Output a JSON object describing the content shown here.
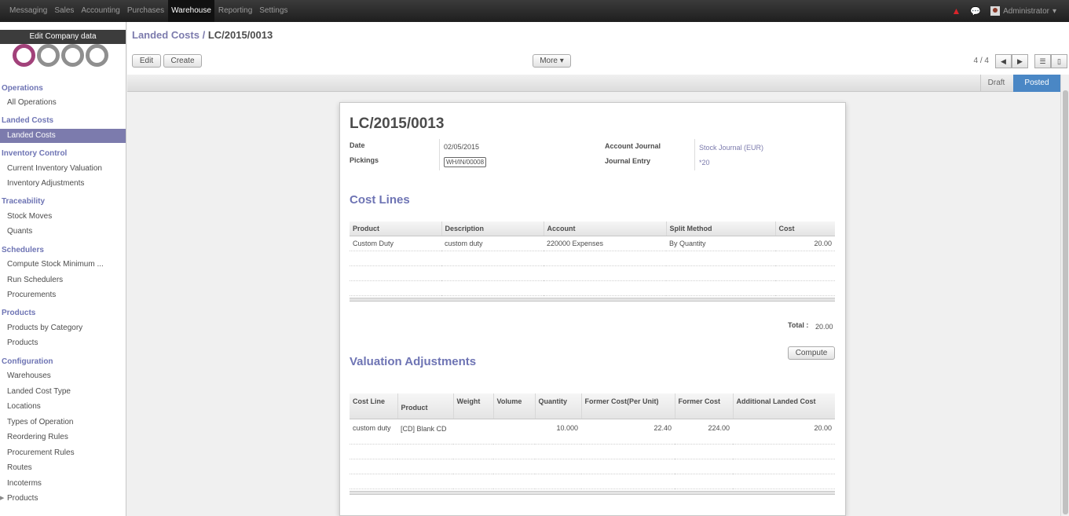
{
  "topbar": {
    "menu": [
      "Messaging",
      "Sales",
      "Accounting",
      "Purchases",
      "Warehouse",
      "Reporting",
      "Settings"
    ],
    "active": "Warehouse",
    "user": "Administrator",
    "caret": "▾"
  },
  "sidebar": {
    "edit_company": "Edit Company data",
    "operations": "Operations",
    "all_operations": "All Operations",
    "landed_costs_sec": "Landed Costs",
    "landed_costs_item": "Landed Costs",
    "inventory_control": "Inventory Control",
    "current_inventory_valuation": "Current Inventory Valuation",
    "inventory_adjustments": "Inventory Adjustments",
    "traceability": "Traceability",
    "stock_moves": "Stock Moves",
    "quants": "Quants",
    "schedulers": "Schedulers",
    "compute_stock_minimum": "Compute Stock Minimum ...",
    "run_schedulers": "Run Schedulers",
    "procurements": "Procurements",
    "products_sec": "Products",
    "products_by_category": "Products by Category",
    "products_item": "Products",
    "configuration": "Configuration",
    "warehouses": "Warehouses",
    "landed_cost_type": "Landed Cost Type",
    "locations": "Locations",
    "types_of_operation": "Types of Operation",
    "reordering_rules": "Reordering Rules",
    "procurement_rules": "Procurement Rules",
    "routes": "Routes",
    "incoterms": "Incoterms",
    "products_config": "Products"
  },
  "header": {
    "breadcrumb_link": "Landed Costs",
    "breadcrumb_sep": " / ",
    "breadcrumb_current": "LC/2015/0013",
    "edit_label": "Edit",
    "create_label": "Create",
    "more_label": "More ▾",
    "pager": "4 / 4"
  },
  "status": {
    "draft": "Draft",
    "posted": "Posted"
  },
  "form": {
    "title": "LC/2015/0013",
    "date_label": "Date",
    "date_value": "02/05/2015",
    "pickings_label": "Pickings",
    "pickings_value": "WH/IN/00008",
    "account_journal_label": "Account Journal",
    "account_journal_value": "Stock Journal (EUR)",
    "journal_entry_label": "Journal Entry",
    "journal_entry_value": "*20"
  },
  "cost_lines": {
    "title": "Cost Lines",
    "headers": [
      "Product",
      "Description",
      "Account",
      "Split Method",
      "Cost"
    ],
    "rows": [
      [
        "Custom Duty",
        "custom duty",
        "220000 Expenses",
        "By Quantity",
        "20.00"
      ]
    ],
    "total_label": "Total :",
    "total_value": "20.00",
    "compute_label": "Compute"
  },
  "valuation": {
    "title": "Valuation Adjustments",
    "headers": [
      "Cost Line",
      "Product",
      "Weight",
      "Volume",
      "Quantity",
      "Former Cost(Per Unit)",
      "Former Cost",
      "Additional Landed Cost"
    ],
    "rows": [
      [
        "custom duty",
        "[CD] Blank CD",
        "",
        "",
        "10.000",
        "22.40",
        "224.00",
        "20.00"
      ]
    ]
  },
  "colors": {
    "accent": "#7c7bad",
    "posted": "#4a87c5",
    "topbar": "#2d2d2d",
    "alert": "#d9242a"
  },
  "icons": [
    "alert-icon",
    "chat-icon",
    "avatar-icon",
    "prev-arrow-icon",
    "next-arrow-icon",
    "list-view-icon",
    "form-view-icon"
  ]
}
